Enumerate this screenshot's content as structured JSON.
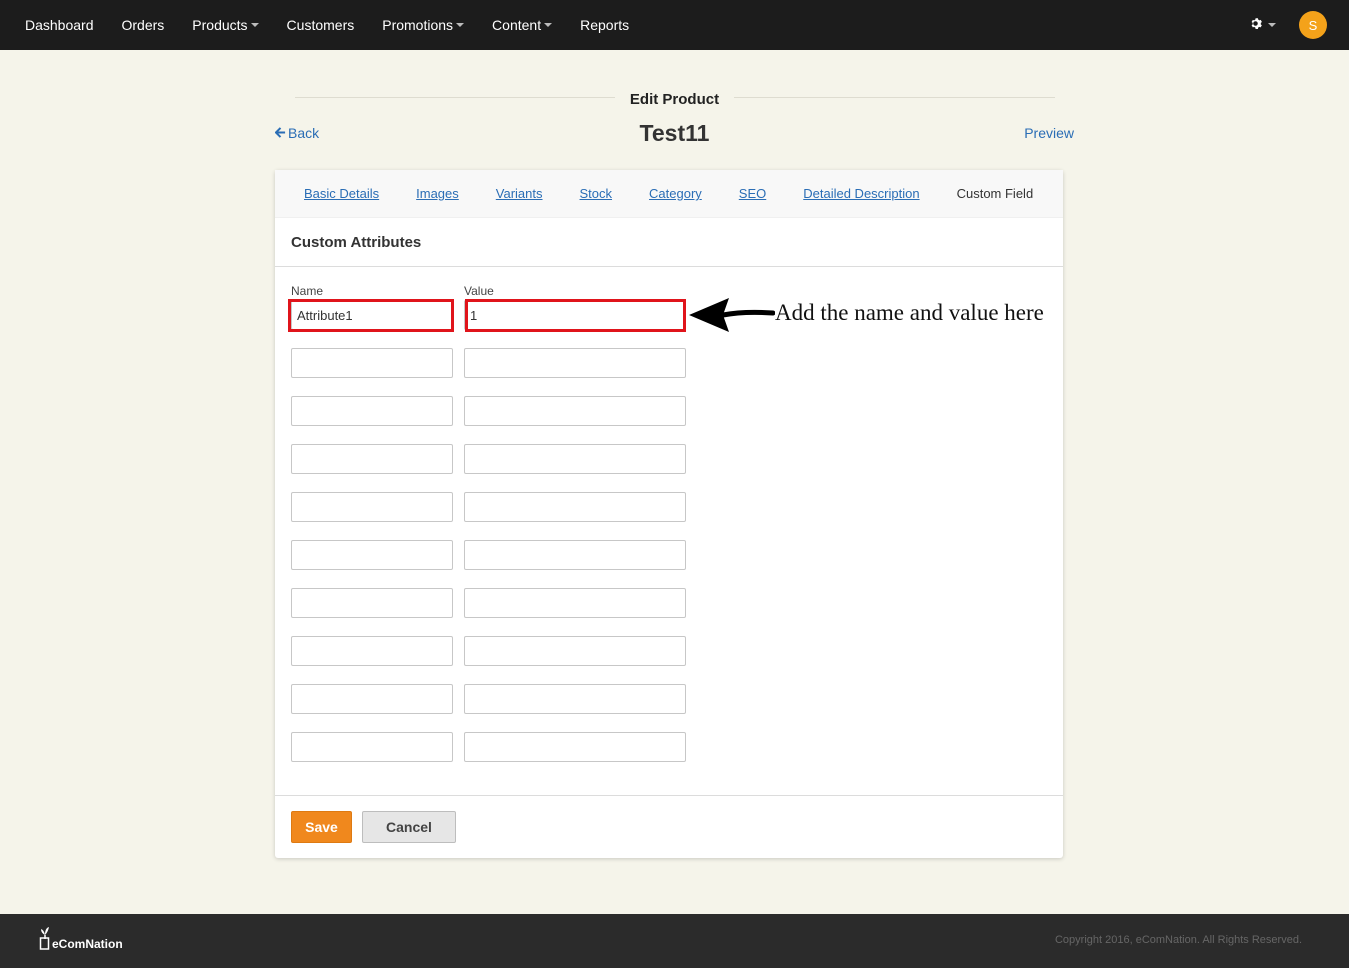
{
  "nav": {
    "items": [
      {
        "label": "Dashboard",
        "dropdown": false
      },
      {
        "label": "Orders",
        "dropdown": false
      },
      {
        "label": "Products",
        "dropdown": true
      },
      {
        "label": "Customers",
        "dropdown": false
      },
      {
        "label": "Promotions",
        "dropdown": true
      },
      {
        "label": "Content",
        "dropdown": true
      },
      {
        "label": "Reports",
        "dropdown": false
      }
    ],
    "settings_icon": "gear-icon",
    "avatar_initial": "S",
    "avatar_color": "#f4a21a"
  },
  "page": {
    "heading": "Edit Product",
    "back_label": "Back",
    "product_name": "Test11",
    "preview_label": "Preview"
  },
  "tabs": [
    {
      "label": "Basic Details",
      "active": false
    },
    {
      "label": "Images",
      "active": false
    },
    {
      "label": "Variants",
      "active": false
    },
    {
      "label": "Stock",
      "active": false
    },
    {
      "label": "Category",
      "active": false
    },
    {
      "label": "SEO",
      "active": false
    },
    {
      "label": "Detailed Description",
      "active": false
    },
    {
      "label": "Custom Field",
      "active": true
    }
  ],
  "form": {
    "section_title": "Custom Attributes",
    "name_label": "Name",
    "value_label": "Value",
    "rows": [
      {
        "name": "Attribute1",
        "value": "1"
      },
      {
        "name": "",
        "value": ""
      },
      {
        "name": "",
        "value": ""
      },
      {
        "name": "",
        "value": ""
      },
      {
        "name": "",
        "value": ""
      },
      {
        "name": "",
        "value": ""
      },
      {
        "name": "",
        "value": ""
      },
      {
        "name": "",
        "value": ""
      },
      {
        "name": "",
        "value": ""
      },
      {
        "name": "",
        "value": ""
      }
    ],
    "save_label": "Save",
    "cancel_label": "Cancel"
  },
  "annotation": {
    "text": "Add the name and value here",
    "highlight_color": "#e0141b"
  },
  "footer": {
    "logo_text": "eComNation",
    "copyright": "Copyright 2016, eComNation. All Rights Reserved."
  },
  "colors": {
    "navbar": "#1c1c1c",
    "background": "#f5f4ea",
    "link": "#2a6db5",
    "save_button": "#f0881d",
    "footer": "#2b2b2b"
  }
}
